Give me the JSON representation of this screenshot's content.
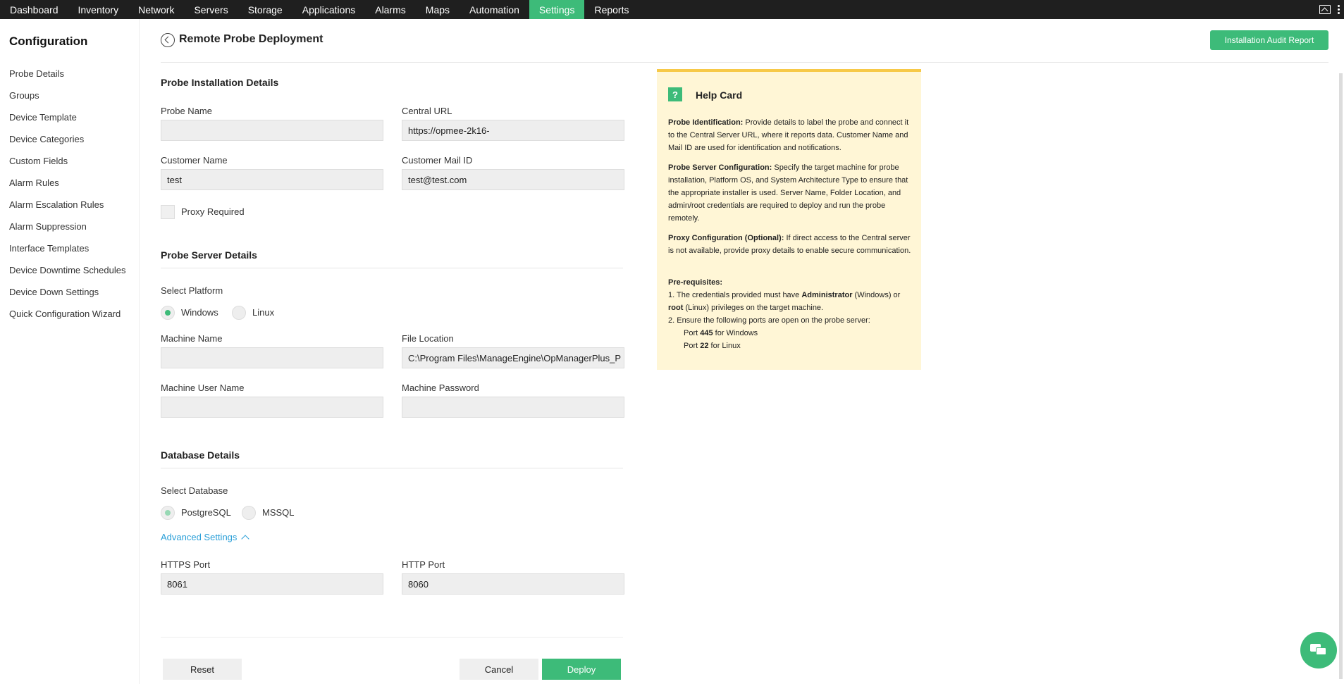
{
  "nav": {
    "tabs": [
      "Dashboard",
      "Inventory",
      "Network",
      "Servers",
      "Storage",
      "Applications",
      "Alarms",
      "Maps",
      "Automation",
      "Settings",
      "Reports"
    ],
    "active": "Settings"
  },
  "sidebar": {
    "title": "Configuration",
    "items": [
      "Probe Details",
      "Groups",
      "Device Template",
      "Device Categories",
      "Custom Fields",
      "Alarm Rules",
      "Alarm Escalation Rules",
      "Alarm Suppression",
      "Interface Templates",
      "Device Downtime Schedules",
      "Device Down Settings",
      "Quick Configuration Wizard"
    ]
  },
  "header": {
    "title": "Remote Probe Deployment",
    "audit_button": "Installation Audit Report"
  },
  "probe_install": {
    "section_title": "Probe Installation Details",
    "probe_name_label": "Probe Name",
    "probe_name_value": "",
    "central_url_label": "Central URL",
    "central_url_value": "https://opmee-2k16-",
    "customer_name_label": "Customer Name",
    "customer_name_value": "test",
    "customer_mail_label": "Customer Mail ID",
    "customer_mail_value": "test@test.com",
    "proxy_label": "Proxy Required"
  },
  "probe_server": {
    "section_title": "Probe Server Details",
    "platform_label": "Select Platform",
    "platform_windows": "Windows",
    "platform_linux": "Linux",
    "machine_name_label": "Machine Name",
    "file_location_label": "File Location",
    "file_location_value": "C:\\Program Files\\ManageEngine\\OpManagerPlus_P",
    "machine_user_label": "Machine User Name",
    "machine_password_label": "Machine Password"
  },
  "database": {
    "section_title": "Database Details",
    "select_label": "Select Database",
    "opt_postgres": "PostgreSQL",
    "opt_mssql": "MSSQL",
    "advanced_label": "Advanced Settings",
    "https_port_label": "HTTPS Port",
    "https_port_value": "8061",
    "http_port_label": "HTTP Port",
    "http_port_value": "8060"
  },
  "buttons": {
    "reset": "Reset",
    "cancel": "Cancel",
    "deploy": "Deploy"
  },
  "help": {
    "icon": "?",
    "title": "Help Card",
    "p1_bold": "Probe Identification:",
    "p1_text": " Provide details to label the probe and connect it to the Central Server URL, where it reports data. Customer Name and Mail ID are used for identification and notifications.",
    "p2_bold": "Probe Server Configuration:",
    "p2_text": " Specify the target machine for probe installation, Platform OS, and System Architecture Type to ensure that the appropriate installer is used. Server Name, Folder Location, and admin/root credentials are required to deploy and run the probe remotely.",
    "p3_bold": "Proxy Configuration (Optional):",
    "p3_text": " If direct access to the Central server is not available, provide proxy details to enable secure communication.",
    "prereq_title": "Pre-requisites:",
    "pre1_a": "1. The credentials provided must have ",
    "pre1_b": "Administrator",
    "pre1_c": " (Windows) or ",
    "pre1_d": "root",
    "pre1_e": " (Linux) privileges on the target machine.",
    "pre2": "2. Ensure the following ports are open on the probe server:",
    "port1_a": "Port ",
    "port1_b": "445",
    "port1_c": " for Windows",
    "port2_a": "Port ",
    "port2_b": "22",
    "port2_c": " for Linux"
  }
}
